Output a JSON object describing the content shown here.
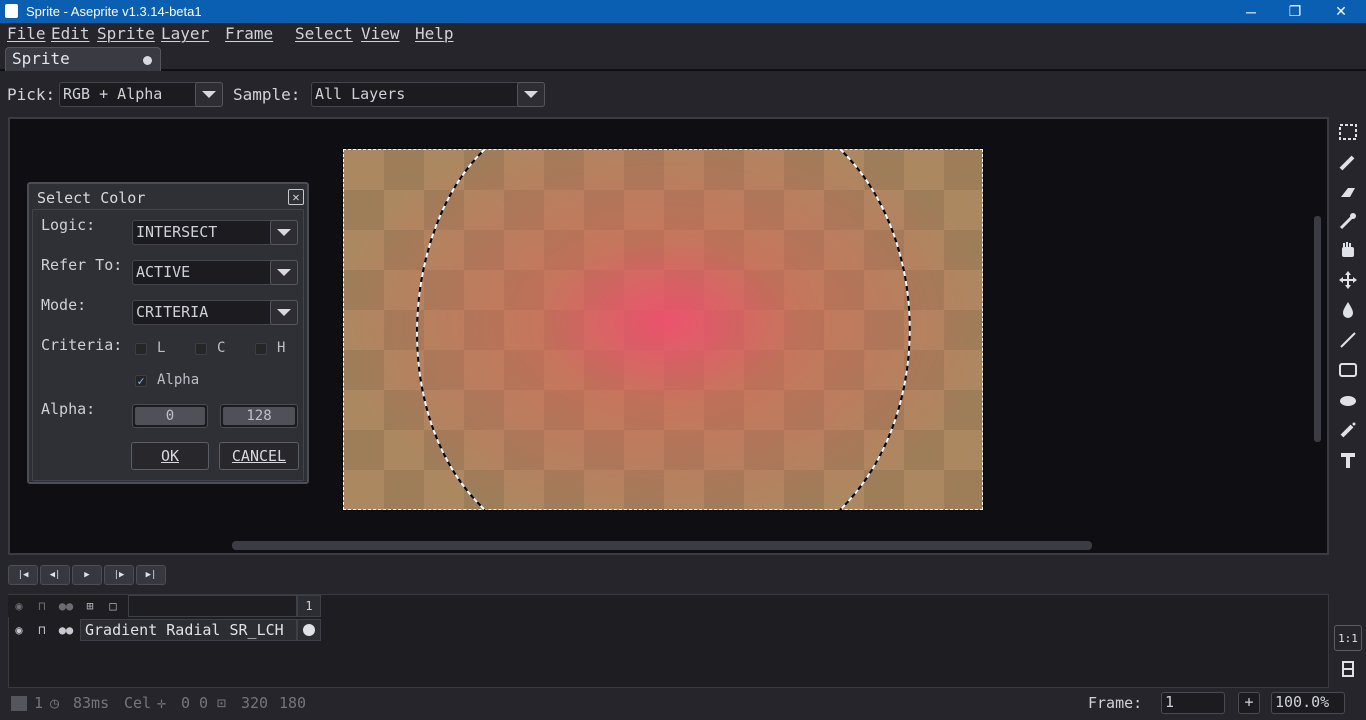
{
  "window": {
    "title": "Sprite - Aseprite v1.3.14-beta1",
    "minimize": "─",
    "maximize": "❐",
    "close": "✕"
  },
  "menu": [
    "File",
    "Edit",
    "Sprite",
    "Layer",
    "Frame",
    "Select",
    "View",
    "Help"
  ],
  "tab": {
    "label": "Sprite"
  },
  "context": {
    "pick_label": "Pick:",
    "pick_value": "RGB + Alpha",
    "sample_label": "Sample:",
    "sample_value": "All Layers"
  },
  "dialog": {
    "title": "Select Color",
    "logic_label": "Logic:",
    "logic_value": "INTERSECT",
    "refer_label": "Refer To:",
    "refer_value": "ACTIVE",
    "mode_label": "Mode:",
    "mode_value": "CRITERIA",
    "criteria_label": "Criteria:",
    "criteria": [
      {
        "label": "L",
        "checked": false
      },
      {
        "label": "C",
        "checked": false
      },
      {
        "label": "H",
        "checked": false
      }
    ],
    "alpha_check": {
      "label": "Alpha",
      "checked": true
    },
    "alpha_label": "Alpha:",
    "alpha_min": "0",
    "alpha_max": "128",
    "ok": "OK",
    "cancel": "CANCEL"
  },
  "tools": [
    "rectangular-marquee-icon",
    "pencil-icon",
    "eraser-icon",
    "eyedropper-icon",
    "hand-icon",
    "move-icon",
    "paint-bucket-icon",
    "line-icon",
    "rectangle-icon",
    "blur-icon",
    "spray-icon",
    "text-icon"
  ],
  "timeline": {
    "frame_number": "1",
    "layer_name": "Gradient Radial SR_LCH"
  },
  "zoom_buttons": {
    "one_to_one": "1:1"
  },
  "status": {
    "frames": "1",
    "duration": "83ms",
    "cel": "Cel",
    "pos_x": "0",
    "pos_y": "0",
    "width": "320",
    "height": "180",
    "frame_label": "Frame:",
    "frame_value": "1",
    "add": "+",
    "zoom": "100.0%"
  },
  "colors": {
    "titlebar": "#0a5fb3",
    "background": "#25252b",
    "selection": "#ffffff",
    "gradient_center": "#f0506e"
  }
}
